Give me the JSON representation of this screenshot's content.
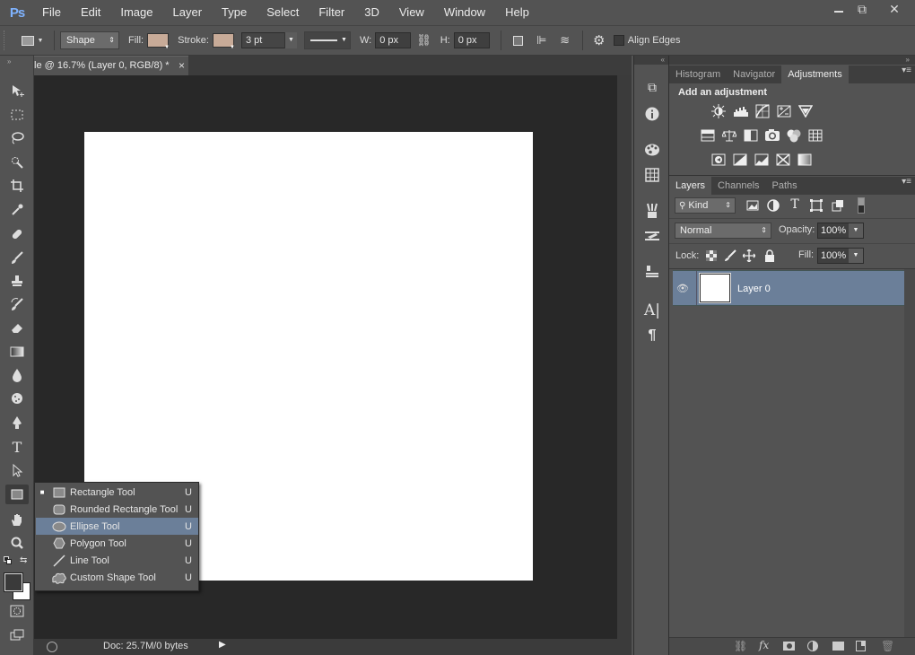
{
  "menubar": {
    "logo": "Ps",
    "items": [
      "File",
      "Edit",
      "Image",
      "Layer",
      "Type",
      "Select",
      "Filter",
      "3D",
      "View",
      "Window",
      "Help"
    ]
  },
  "window_controls": {
    "minimize": "▭",
    "restore": "⧉",
    "close": "✕"
  },
  "options": {
    "mode": "Shape",
    "fill_label": "Fill:",
    "stroke_label": "Stroke:",
    "stroke_width": "3 pt",
    "w_label": "W:",
    "w_value": "0 px",
    "h_label": "H:",
    "h_value": "0 px",
    "align_edges": "Align Edges",
    "fill_color": "#c8ab98",
    "stroke_color": "#c8ab98"
  },
  "document": {
    "tab_title": "le @ 16.7% (Layer 0, RGB/8) *",
    "close": "×",
    "status": "Doc: 25.7M/0 bytes"
  },
  "shape_flyout": {
    "items": [
      {
        "label": "Rectangle Tool",
        "key": "U",
        "icon": "rectangle-icon",
        "current": true
      },
      {
        "label": "Rounded Rectangle Tool",
        "key": "U",
        "icon": "rounded-rectangle-icon"
      },
      {
        "label": "Ellipse Tool",
        "key": "U",
        "icon": "ellipse-icon",
        "highlighted": true
      },
      {
        "label": "Polygon Tool",
        "key": "U",
        "icon": "polygon-icon"
      },
      {
        "label": "Line Tool",
        "key": "U",
        "icon": "line-icon"
      },
      {
        "label": "Custom Shape Tool",
        "key": "U",
        "icon": "custom-shape-icon"
      }
    ]
  },
  "top_panel": {
    "tabs": [
      "Histogram",
      "Navigator",
      "Adjustments"
    ],
    "active": "Adjustments",
    "heading": "Add an adjustment"
  },
  "layers_panel": {
    "tabs": [
      "Layers",
      "Channels",
      "Paths"
    ],
    "active": "Layers",
    "kind": "Kind",
    "blend_mode": "Normal",
    "opacity_label": "Opacity:",
    "opacity": "100%",
    "lock_label": "Lock:",
    "fill_label": "Fill:",
    "fill": "100%",
    "layers": [
      {
        "name": "Layer 0",
        "selected": true
      }
    ]
  },
  "colors": {
    "accent": "#6b7f99",
    "ui": "#535353",
    "pasteboard": "#282828"
  }
}
